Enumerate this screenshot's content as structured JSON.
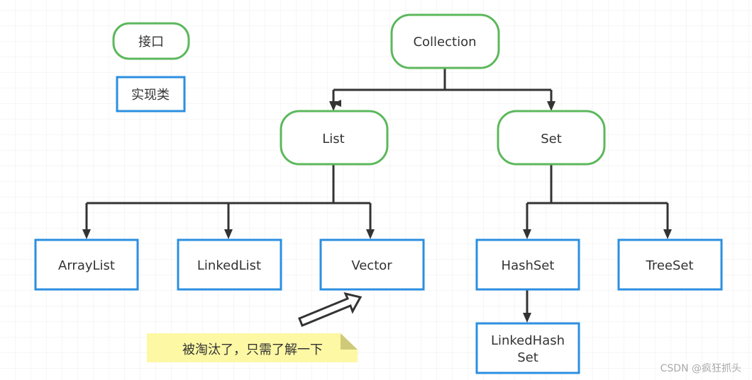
{
  "legend": {
    "interface": "接口",
    "implementation": "实现类"
  },
  "nodes": {
    "collection": "Collection",
    "list": "List",
    "set": "Set",
    "arraylist": "ArrayList",
    "linkedlist": "LinkedList",
    "vector": "Vector",
    "hashset": "HashSet",
    "treeset": "TreeSet",
    "linkedhashset_line1": "LinkedHash",
    "linkedhashset_line2": "Set"
  },
  "note": "被淘汰了，只需了解一下",
  "watermark": "CSDN @疯狂抓头",
  "colors": {
    "interface_border": "#5cb85c",
    "class_border": "#2b8fe0",
    "note_fill": "#fdf8a4",
    "connector": "#333333"
  }
}
